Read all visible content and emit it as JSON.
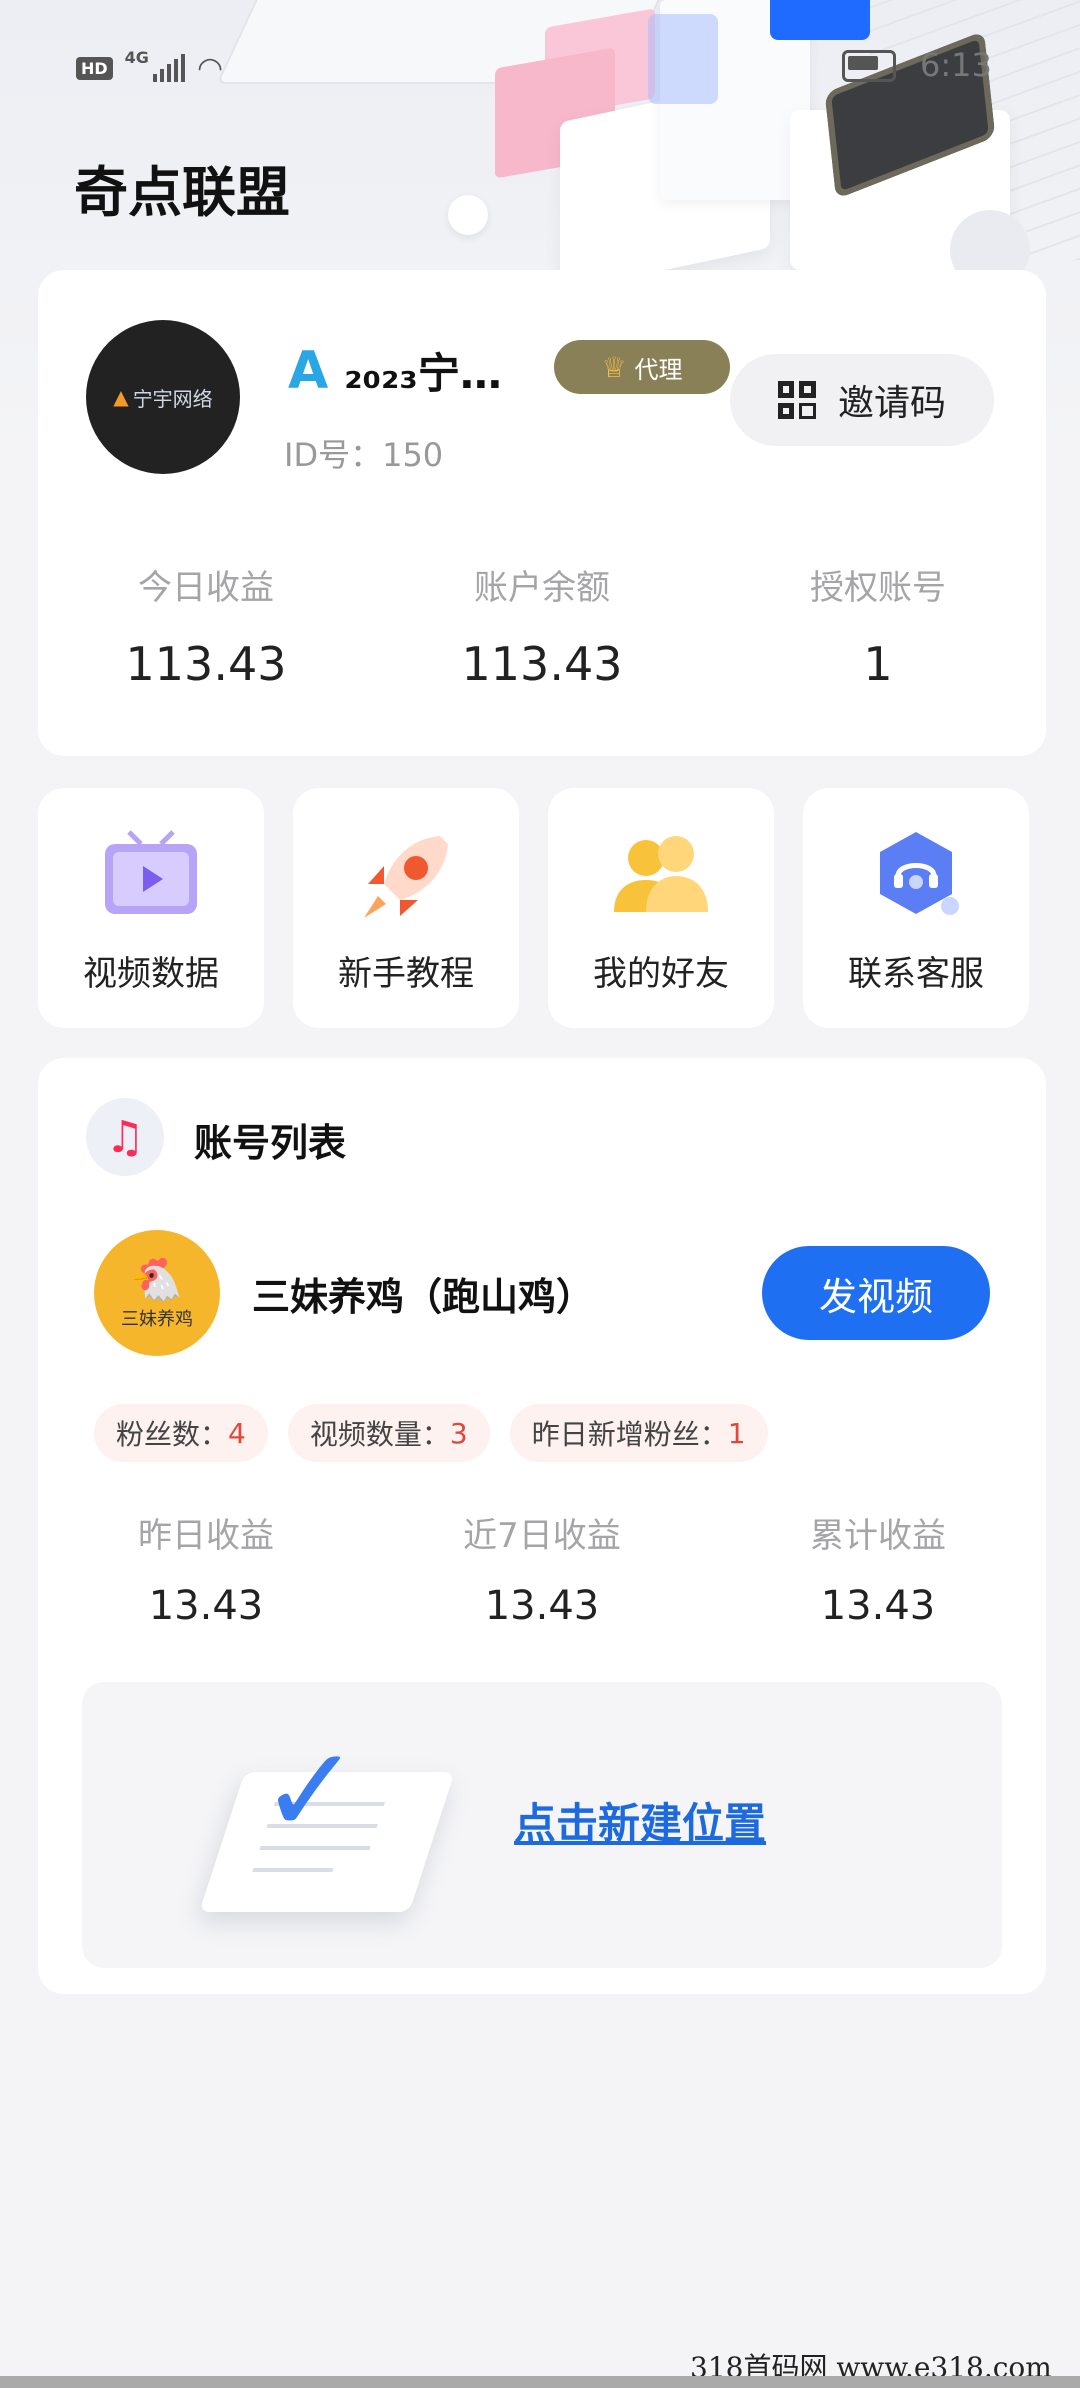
{
  "status_bar": {
    "hd": "HD",
    "network": "4G",
    "time": "6:13"
  },
  "app": {
    "title": "奇点联盟"
  },
  "user": {
    "avatar_text": "宁宇网络",
    "name_prefix": "A",
    "name": "₂₀₂₃宁…",
    "badge": "代理",
    "id_label": "ID号：150",
    "invite_label": "邀请码",
    "stats": [
      {
        "label": "今日收益",
        "value": "113.43"
      },
      {
        "label": "账户余额",
        "value": "113.43"
      },
      {
        "label": "授权账号",
        "value": "1"
      }
    ]
  },
  "quick_actions": [
    {
      "label": "视频数据",
      "icon": "tv-icon"
    },
    {
      "label": "新手教程",
      "icon": "rocket-icon"
    },
    {
      "label": "我的好友",
      "icon": "friends-icon"
    },
    {
      "label": "联系客服",
      "icon": "headset-icon"
    }
  ],
  "accounts": {
    "title": "账号列表",
    "item": {
      "avatar_text": "三妹养鸡",
      "name": "三妹养鸡（跑山鸡）",
      "post_button": "发视频",
      "chips": [
        {
          "label": "粉丝数：",
          "value": "4"
        },
        {
          "label": "视频数量：",
          "value": "3"
        },
        {
          "label": "昨日新增粉丝：",
          "value": "1"
        }
      ],
      "stats": [
        {
          "label": "昨日收益",
          "value": "13.43"
        },
        {
          "label": "近7日收益",
          "value": "13.43"
        },
        {
          "label": "累计收益",
          "value": "13.43"
        }
      ]
    },
    "new_position_label": "点击新建位置"
  },
  "watermark": "318首码网  www.e318.com",
  "colors": {
    "accent_blue": "#1f6ff2",
    "badge_gold": "#8a8058",
    "chip_number": "#e2473b",
    "background": "#f4f4f6"
  }
}
